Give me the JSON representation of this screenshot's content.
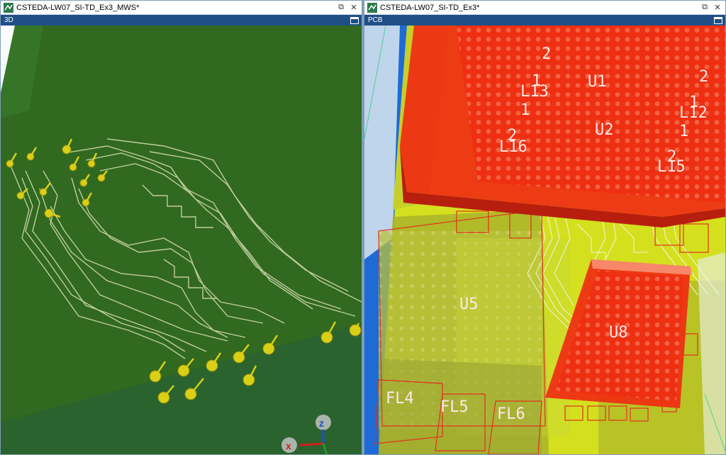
{
  "windows": {
    "left": {
      "title": "CSTEDA-LW07_SI-TD_Ex3_MWS*",
      "view_tab": "3D"
    },
    "right": {
      "title": "CSTEDA-LW07_SI-TD_Ex3*",
      "view_tab": "PCB"
    }
  },
  "axes": {
    "z": "z",
    "x": "x",
    "y": "y"
  },
  "pcb_labels": {
    "u1": "U1",
    "u2": "U2",
    "u5": "U5",
    "u8": "U8",
    "l12": "L12",
    "l13": "L13",
    "l15": "L15",
    "l16": "L16",
    "fl4": "FL4",
    "fl5": "FL5",
    "fl6": "FL6",
    "pin_a": "2",
    "pin_b": "1",
    "pin_c": "1",
    "pin_d": "2",
    "pin_e": "1",
    "pin_f": "1",
    "pin_g": "2",
    "pin_h": "2"
  },
  "icons": [
    "app-icon",
    "restore-icon",
    "close-icon",
    "maximize-icon",
    "axis-gizmo"
  ],
  "colors": {
    "board_green": "#2f6d21",
    "trace": "#cfd8b0",
    "pad": "#d9cf17",
    "pcb_yellow": "#d6e21e",
    "component_red": "#ef2d12",
    "tab_blue": "#1f4f86"
  }
}
